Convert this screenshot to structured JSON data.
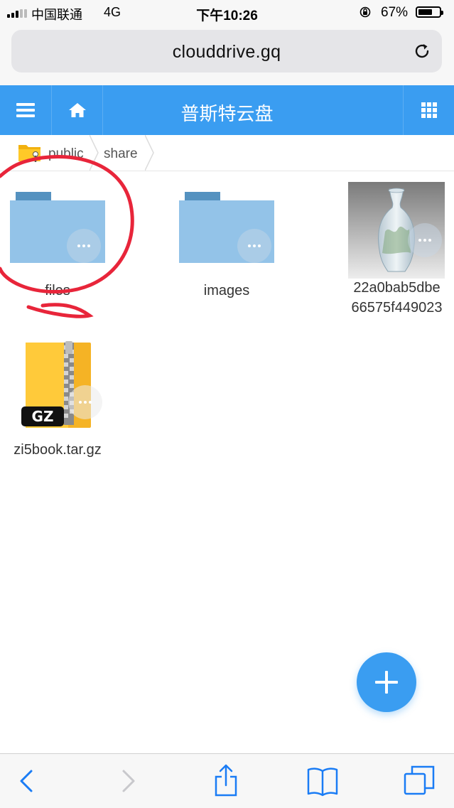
{
  "status_bar": {
    "carrier": "中国联通",
    "network": "4G",
    "time": "下午10:26",
    "battery": "67%",
    "battery_level": 0.67
  },
  "browser": {
    "url": "clouddrive.gq"
  },
  "header": {
    "title": "普斯特云盘"
  },
  "breadcrumb": {
    "items": [
      "public",
      "share"
    ]
  },
  "files": [
    {
      "name": "files",
      "type": "folder"
    },
    {
      "name": "images",
      "type": "folder"
    },
    {
      "name_line1": "22a0bab5dbe",
      "name_line2": "66575f449023",
      "type": "image"
    },
    {
      "name": "zi5book.tar.gz",
      "type": "archive",
      "badge": "GZ"
    }
  ],
  "colors": {
    "accent": "#3a9df1",
    "folder": "#93c3e8",
    "annotation": "#e8253a"
  }
}
